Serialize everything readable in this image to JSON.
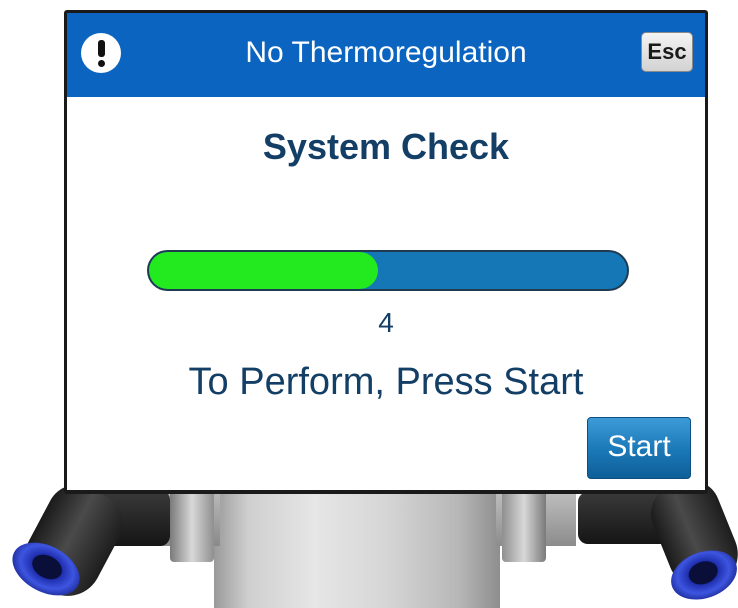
{
  "header": {
    "icon": "alert-exclamation-icon",
    "title": "No Thermoregulation",
    "esc_label": "Esc",
    "background_color": "#0a64c0"
  },
  "main": {
    "title": "System Check",
    "progress": {
      "fraction": 0.48,
      "fill_color": "#22ea1e",
      "track_color": "#1577b6"
    },
    "count": "4",
    "instruction": "To Perform, Press Start",
    "start_label": "Start"
  },
  "colors": {
    "text": "#133e66",
    "accent": "#0a64c0"
  }
}
